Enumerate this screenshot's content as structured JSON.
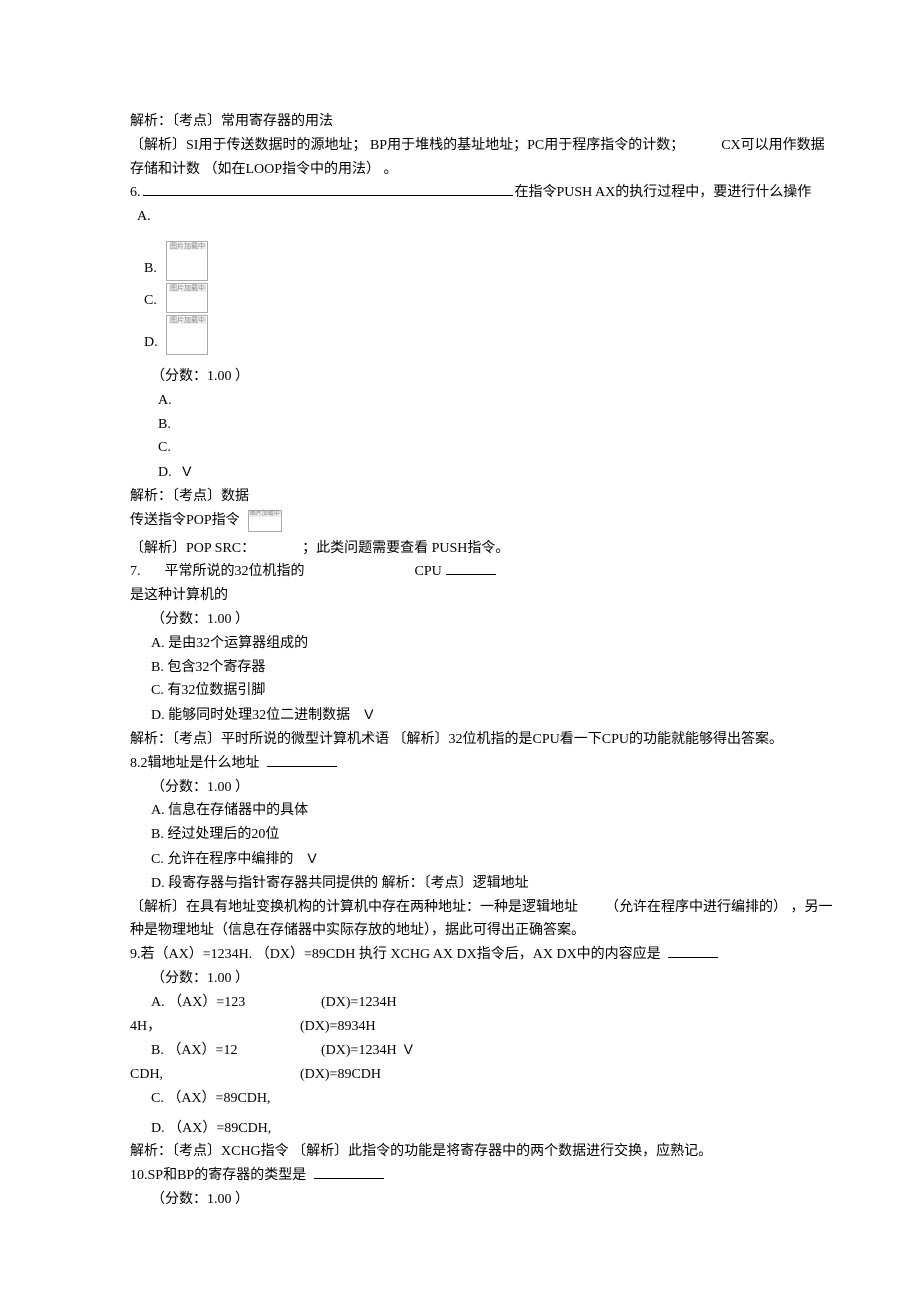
{
  "pre": {
    "l1": "解析：〔考点〕常用寄存器的用法",
    "l2": "〔解析〕SI用于传送数据时的源地址； BP用于堆栈的基址地址；PC用于程序指令的计数；",
    "l2_tail": "CX可以用作数据",
    "l3": "存储和计数 （如在LOOP指令中的用法） 。"
  },
  "q6": {
    "num": "6.",
    "stem_tail": "在指令PUSH AX的执行过程中，要进行什么操作",
    "A": "A.",
    "B": "B.",
    "C": "C.",
    "D": "D.",
    "score": "（分数：1.00 ）",
    "aA": "A.",
    "aB": "B.",
    "aC": "C.",
    "aD": "D.",
    "check": "V",
    "exp1": "解析：〔考点〕数据",
    "exp2": "传送指令POP指令",
    "exp3_pre": "〔解析〕POP SRC：",
    "exp3_post": "；此类问题需要查看  PUSH指令。",
    "img_tag": "图片加载中"
  },
  "q7": {
    "num": "7.",
    "stem1": "平常所说的32位机指的",
    "cpu": "CPU",
    "stem2": "是这种计算机的",
    "score": "（分数：1.00 ）",
    "A": "A.  是由32个运算器组成的",
    "B": "B.  包含32个寄存器",
    "C": "C.  有32位数据引脚",
    "D": "D.  能够同时处理32位二进制数据",
    "check": "V",
    "exp": "解析：〔考点〕平时所说的微型计算机术语 〔解析〕32位机指的是CPU看一下CPU的功能就能够得出答案。"
  },
  "q8": {
    "stem": "8.2辑地址是什么地址",
    "score": "（分数：1.00 ）",
    "A": "A.  信息在存储器中的具体",
    "B": "B.  经过处理后的20位",
    "C": "C.  允许在程序中编排的",
    "check": "V",
    "D": "D.  段寄存器与指针寄存器共同提供的 解析：〔考点〕逻辑地址",
    "exp1": "〔解析〕在具有地址变换机构的计算机中存在两种地址：一种是逻辑地址",
    "exp1_tail": "（允许在程序中进行编排的） ，另一",
    "exp2": "种是物理地址（信息在存储器中实际存放的地址），据此可得出正确答案。"
  },
  "q9": {
    "stem": "9.若（AX）=1234H. （DX）=89CDH 执行  XCHG AX DX指令后，AX DX中的内容应是",
    "score": "（分数：1.00 ）",
    "A_l": "A. （AX）=123",
    "A_cont": "4H，",
    "B_l": "B. （AX）=12",
    "B_cont": "CDH,",
    "dx1": "(DX)=1234H",
    "dx2": "(DX)=8934H",
    "dx3": "(DX)=1234H",
    "check": "V",
    "dx4": "(DX)=89CDH",
    "C": "C. （AX）=89CDH,",
    "D": "D.   （AX）=89CDH,",
    "exp": "解析：〔考点〕XCHG指令 〔解析〕此指令的功能是将寄存器中的两个数据进行交换，应熟记。"
  },
  "q10": {
    "stem": "10.SP和BP的寄存器的类型是",
    "score": "（分数：1.00 ）"
  }
}
